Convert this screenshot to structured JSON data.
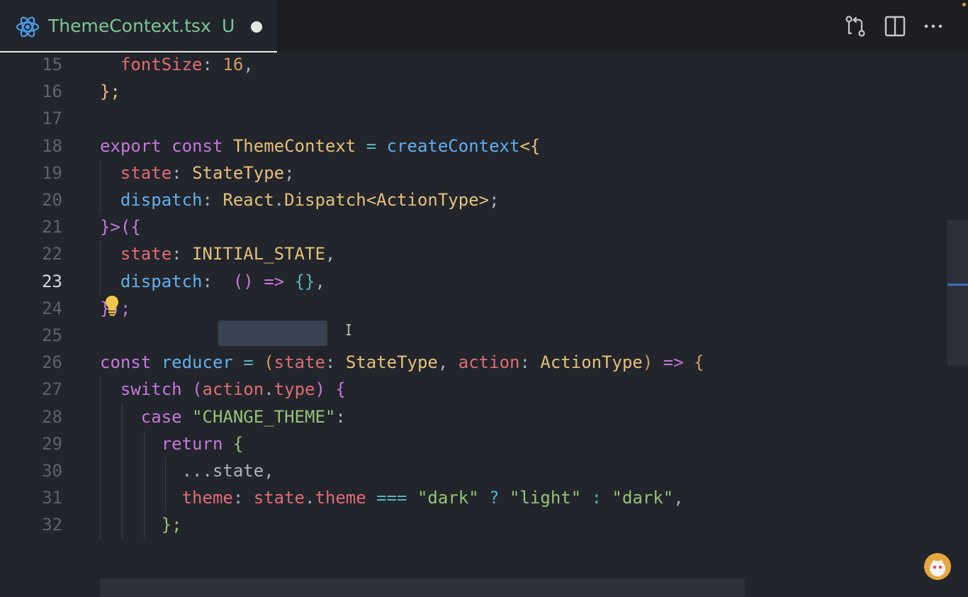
{
  "tab": {
    "title": "ThemeContext.tsx",
    "status": "U",
    "icon": "react-icon",
    "dirty": true
  },
  "toolbar": {
    "actions": [
      "open-changes-icon",
      "split-editor-icon",
      "more-actions-icon"
    ]
  },
  "editor": {
    "active_line": "23",
    "line_numbers": [
      "15",
      "16",
      "17",
      "18",
      "19",
      "20",
      "21",
      "22",
      "23",
      "24",
      "25",
      "26",
      "27",
      "28",
      "29",
      "30",
      "31",
      "32"
    ],
    "lines": [
      [
        {
          "t": "  "
        },
        {
          "t": "fontSize",
          "c": "prop"
        },
        {
          "t": ": ",
          "c": "pl"
        },
        {
          "t": "16",
          "c": "num"
        },
        {
          "t": ",",
          "c": "pl"
        }
      ],
      [
        {
          "t": "};",
          "c": "type"
        }
      ],
      [],
      [
        {
          "t": "export",
          "c": "kw"
        },
        {
          "t": " ",
          "c": "pl"
        },
        {
          "t": "const",
          "c": "kw"
        },
        {
          "t": " ",
          "c": "pl"
        },
        {
          "t": "ThemeContext",
          "c": "type"
        },
        {
          "t": " ",
          "c": "pl"
        },
        {
          "t": "=",
          "c": "op"
        },
        {
          "t": " ",
          "c": "pl"
        },
        {
          "t": "createContext",
          "c": "fn"
        },
        {
          "t": "<{",
          "c": "type"
        }
      ],
      [
        {
          "t": "  "
        },
        {
          "t": "state",
          "c": "prop"
        },
        {
          "t": ": ",
          "c": "pl"
        },
        {
          "t": "StateType",
          "c": "type"
        },
        {
          "t": ";",
          "c": "pl"
        }
      ],
      [
        {
          "t": "  "
        },
        {
          "t": "dispatch",
          "c": "fn"
        },
        {
          "t": ": ",
          "c": "pl"
        },
        {
          "t": "React",
          "c": "type"
        },
        {
          "t": ".",
          "c": "pl"
        },
        {
          "t": "Dispatch",
          "c": "type"
        },
        {
          "t": "<",
          "c": "type"
        },
        {
          "t": "ActionType",
          "c": "type"
        },
        {
          "t": ">",
          "c": "type"
        },
        {
          "t": ";",
          "c": "pl"
        }
      ],
      [
        {
          "t": "}>({",
          "c": "kw"
        }
      ],
      [
        {
          "t": "  "
        },
        {
          "t": "state",
          "c": "prop"
        },
        {
          "t": ": ",
          "c": "pl"
        },
        {
          "t": "INITIAL_STATE",
          "c": "type"
        },
        {
          "t": ",",
          "c": "pl"
        }
      ],
      [
        {
          "t": "  "
        },
        {
          "t": "dispatch",
          "c": "fn"
        },
        {
          "t": ": ",
          "c": "pl"
        },
        {
          "t": " ",
          "c": "pl"
        },
        {
          "t": "()",
          "c": "kw"
        },
        {
          "t": " ",
          "c": "pl"
        },
        {
          "t": "=>",
          "c": "kw"
        },
        {
          "t": " ",
          "c": "pl"
        },
        {
          "t": "{}",
          "c": "op"
        },
        {
          "t": ",",
          "c": "pl"
        }
      ],
      [
        {
          "t": "});",
          "c": "kw"
        }
      ],
      [],
      [
        {
          "t": "const",
          "c": "kw"
        },
        {
          "t": " ",
          "c": "pl"
        },
        {
          "t": "reducer",
          "c": "fn"
        },
        {
          "t": " ",
          "c": "pl"
        },
        {
          "t": "=",
          "c": "op"
        },
        {
          "t": " ",
          "c": "pl"
        },
        {
          "t": "(",
          "c": "num"
        },
        {
          "t": "state",
          "c": "prop"
        },
        {
          "t": ": ",
          "c": "pl"
        },
        {
          "t": "StateType",
          "c": "type"
        },
        {
          "t": ", ",
          "c": "pl"
        },
        {
          "t": "action",
          "c": "prop"
        },
        {
          "t": ": ",
          "c": "pl"
        },
        {
          "t": "ActionType",
          "c": "type"
        },
        {
          "t": ")",
          "c": "num"
        },
        {
          "t": " ",
          "c": "pl"
        },
        {
          "t": "=>",
          "c": "kw"
        },
        {
          "t": " ",
          "c": "pl"
        },
        {
          "t": "{",
          "c": "num"
        }
      ],
      [
        {
          "t": "  "
        },
        {
          "t": "switch",
          "c": "kw"
        },
        {
          "t": " ",
          "c": "pl"
        },
        {
          "t": "(",
          "c": "kw"
        },
        {
          "t": "action",
          "c": "prop"
        },
        {
          "t": ".",
          "c": "pl"
        },
        {
          "t": "type",
          "c": "prop"
        },
        {
          "t": ")",
          "c": "kw"
        },
        {
          "t": " ",
          "c": "pl"
        },
        {
          "t": "{",
          "c": "kw"
        }
      ],
      [
        {
          "t": "    "
        },
        {
          "t": "case",
          "c": "kw"
        },
        {
          "t": " ",
          "c": "pl"
        },
        {
          "t": "\"CHANGE_THEME\"",
          "c": "str"
        },
        {
          "t": ":",
          "c": "pl"
        }
      ],
      [
        {
          "t": "      "
        },
        {
          "t": "return",
          "c": "kw"
        },
        {
          "t": " ",
          "c": "pl"
        },
        {
          "t": "{",
          "c": "str"
        }
      ],
      [
        {
          "t": "        "
        },
        {
          "t": "...state",
          "c": "pl"
        },
        {
          "t": ",",
          "c": "pl"
        }
      ],
      [
        {
          "t": "        "
        },
        {
          "t": "theme",
          "c": "prop"
        },
        {
          "t": ": ",
          "c": "pl"
        },
        {
          "t": "state",
          "c": "prop"
        },
        {
          "t": ".",
          "c": "pl"
        },
        {
          "t": "theme",
          "c": "prop"
        },
        {
          "t": " ",
          "c": "pl"
        },
        {
          "t": "===",
          "c": "op"
        },
        {
          "t": " ",
          "c": "pl"
        },
        {
          "t": "\"dark\"",
          "c": "str"
        },
        {
          "t": " ",
          "c": "pl"
        },
        {
          "t": "?",
          "c": "op"
        },
        {
          "t": " ",
          "c": "pl"
        },
        {
          "t": "\"light\"",
          "c": "str"
        },
        {
          "t": " ",
          "c": "pl"
        },
        {
          "t": ":",
          "c": "op"
        },
        {
          "t": " ",
          "c": "pl"
        },
        {
          "t": "\"dark\"",
          "c": "str"
        },
        {
          "t": ",",
          "c": "pl"
        }
      ],
      [
        {
          "t": "      "
        },
        {
          "t": "};",
          "c": "str"
        }
      ]
    ]
  },
  "colors": {
    "keyword": "#c678dd",
    "function": "#61afef",
    "property": "#e06c75",
    "number": "#d19a66",
    "type": "#e5c07b",
    "string": "#98c379",
    "operator": "#56b6c2",
    "tab_title": "#7ec699"
  }
}
